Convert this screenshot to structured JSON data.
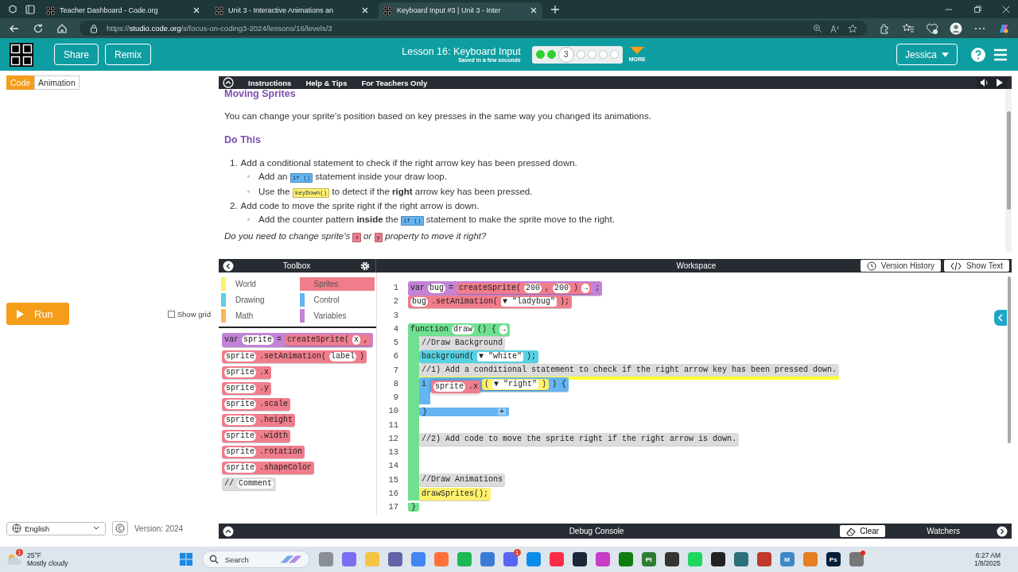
{
  "browser": {
    "tabs": [
      {
        "title": "Teacher Dashboard - Code.org",
        "selected": false
      },
      {
        "title": "Unit 3 - Interactive Animations an",
        "selected": false
      },
      {
        "title": "Keyboard Input #3 | Unit 3 - Inter",
        "selected": true
      }
    ],
    "url": "https://**studio.code.org**/s/focus-on-coding3-2024/lessons/16/levels/3"
  },
  "header": {
    "buttons": [
      "Share",
      "Remix"
    ],
    "lesson_title": "Lesson 16: Keyboard Input",
    "save_status": "Saved in a few seconds",
    "progress": [
      {
        "kind": "done"
      },
      {
        "kind": "done"
      },
      {
        "kind": "current",
        "label": "3"
      },
      {
        "kind": "empty"
      },
      {
        "kind": "empty"
      },
      {
        "kind": "empty"
      },
      {
        "kind": "empty"
      }
    ],
    "more_label": "MORE",
    "user": "Jessica"
  },
  "left_pane": {
    "tabs": [
      {
        "label": "Code",
        "selected": true
      },
      {
        "label": "Animation",
        "selected": false
      }
    ],
    "run_label": "Run",
    "show_grid": {
      "label": "Show grid",
      "checked": false
    },
    "language": "English",
    "version": "Version: 2024"
  },
  "instructions": {
    "tabs": [
      "Instructions",
      "Help & Tips",
      "For Teachers Only"
    ],
    "heading": "Moving Sprites",
    "intro": "You can change your sprite's position based on key presses in the same way you changed its animations.",
    "subheading": "Do This",
    "steps": [
      {
        "marker": "1.",
        "segments": [
          {
            "text": "Add a conditional statement to check if the right arrow key has been pressed down."
          }
        ],
        "children": [
          {
            "marker": "◦",
            "segments": [
              {
                "text": "Add an "
              },
              {
                "code": "if ()",
                "kind": "control"
              },
              {
                "text": " statement inside your draw loop."
              }
            ]
          },
          {
            "marker": "◦",
            "segments": [
              {
                "text": "Use the "
              },
              {
                "code": "keyDown()",
                "kind": "world"
              },
              {
                "text": " to detect if the **right** arrow key has been pressed."
              }
            ]
          }
        ]
      },
      {
        "marker": "2.",
        "segments": [
          {
            "text": "Add code to move the sprite right if the right arrow is down."
          }
        ],
        "children": [
          {
            "marker": "◦",
            "segments": [
              {
                "text": "Add the counter pattern **inside** the "
              },
              {
                "code": "if ()",
                "kind": "control"
              },
              {
                "text": " statement to make the sprite move to the right."
              }
            ]
          }
        ]
      }
    ],
    "question": [
      {
        "text": "Do you need to change sprite's "
      },
      {
        "code": "x",
        "kind": "sprites"
      },
      {
        "text": " or "
      },
      {
        "code": "y",
        "kind": "sprites"
      },
      {
        "text": " property to move it right?"
      }
    ]
  },
  "toolbox": {
    "title": "Toolbox",
    "categories": [
      {
        "label": "World",
        "color": "#fff06e",
        "selected": false
      },
      {
        "label": "Sprites",
        "color": "#f07d8b",
        "selected": true
      },
      {
        "label": "Drawing",
        "color": "#56d2e3",
        "selected": false
      },
      {
        "label": "Control",
        "color": "#64b5f2",
        "selected": false
      },
      {
        "label": "Math",
        "color": "#f7b955",
        "selected": false
      },
      {
        "label": "Variables",
        "color": "#c283d6",
        "selected": false
      }
    ],
    "blocks": [
      {
        "kind": "variables",
        "tokens": [
          {
            "kind": "text",
            "text": "var"
          },
          {
            "kind": "field",
            "text": "sprite"
          },
          {
            "kind": "text",
            "text": "="
          },
          {
            "kind": "sprites",
            "tokens": [
              {
                "kind": "text",
                "text": "createSprite("
              },
              {
                "kind": "field",
                "text": "x"
              },
              {
                "kind": "text",
                "text": ","
              }
            ]
          }
        ]
      },
      {
        "kind": "sprites",
        "tokens": [
          {
            "kind": "field",
            "text": "sprite"
          },
          {
            "kind": "text",
            "text": ".setAnimation("
          },
          {
            "kind": "field",
            "text": "label"
          },
          {
            "kind": "text",
            "text": ")"
          }
        ]
      },
      {
        "kind": "sprites",
        "tokens": [
          {
            "kind": "field",
            "text": "sprite"
          },
          {
            "kind": "text",
            "text": ".x"
          }
        ]
      },
      {
        "kind": "sprites",
        "tokens": [
          {
            "kind": "field",
            "text": "sprite"
          },
          {
            "kind": "text",
            "text": ".y"
          }
        ]
      },
      {
        "kind": "sprites",
        "tokens": [
          {
            "kind": "field",
            "text": "sprite"
          },
          {
            "kind": "text",
            "text": ".scale"
          }
        ]
      },
      {
        "kind": "sprites",
        "tokens": [
          {
            "kind": "field",
            "text": "sprite"
          },
          {
            "kind": "text",
            "text": ".height"
          }
        ]
      },
      {
        "kind": "sprites",
        "tokens": [
          {
            "kind": "field",
            "text": "sprite"
          },
          {
            "kind": "text",
            "text": ".width"
          }
        ]
      },
      {
        "kind": "sprites",
        "tokens": [
          {
            "kind": "field",
            "text": "sprite"
          },
          {
            "kind": "text",
            "text": ".rotation"
          }
        ]
      },
      {
        "kind": "sprites",
        "tokens": [
          {
            "kind": "field",
            "text": "sprite"
          },
          {
            "kind": "text",
            "text": ".shapeColor"
          }
        ]
      },
      {
        "kind": "comment",
        "tokens": [
          {
            "kind": "text",
            "text": "//"
          },
          {
            "kind": "field",
            "text": "Comment"
          }
        ]
      }
    ]
  },
  "workspace": {
    "title": "Workspace",
    "buttons": [
      "Version History",
      "Show Text"
    ],
    "lines": [
      {
        "number": "1",
        "block": {
          "kind": "variables",
          "tokens": [
            {
              "kind": "text",
              "text": "var"
            },
            {
              "kind": "field",
              "text": "bug"
            },
            {
              "kind": "text",
              "text": "="
            },
            {
              "kind": "sprites",
              "tokens": [
                {
                  "kind": "text",
                  "text": "createSprite("
                },
                {
                  "kind": "field",
                  "text": "200"
                },
                {
                  "kind": "text",
                  "text": ","
                },
                {
                  "kind": "field",
                  "text": "200"
                },
                {
                  "kind": "text",
                  "text": ")"
                },
                {
                  "kind": "field",
                  "text": "→"
                }
              ]
            },
            {
              "kind": "text",
              "text": ";"
            }
          ]
        }
      },
      {
        "number": "2",
        "block": {
          "kind": "sprites",
          "tokens": [
            {
              "kind": "field",
              "text": "bug"
            },
            {
              "kind": "text",
              "text": ".setAnimation("
            },
            {
              "kind": "dropdown",
              "text": "▼ \"ladybug\""
            },
            {
              "kind": "text",
              "text": ");"
            }
          ]
        }
      },
      {
        "number": "3"
      },
      {
        "number": "4",
        "block": {
          "kind": "function",
          "tokens": [
            {
              "kind": "text",
              "text": "function"
            },
            {
              "kind": "field",
              "text": "draw"
            },
            {
              "kind": "text",
              "text": "() {"
            },
            {
              "kind": "field",
              "text": "→"
            }
          ]
        },
        "children": [
          {
            "number": "5",
            "block": {
              "kind": "comment",
              "tokens": [
                {
                  "kind": "text",
                  "text": "//Draw Background"
                }
              ]
            }
          },
          {
            "number": "6",
            "block": {
              "kind": "drawing",
              "tokens": [
                {
                  "kind": "text",
                  "text": "background("
                },
                {
                  "kind": "dropdown",
                  "text": "▼ \"white\""
                },
                {
                  "kind": "text",
                  "text": ");"
                }
              ]
            }
          },
          {
            "number": "7",
            "block": {
              "kind": "comment",
              "highlighted": true,
              "tokens": [
                {
                  "kind": "text",
                  "text": "//1) Add a conditional statement to check if the right arrow key has been pressed down."
                }
              ]
            }
          },
          {
            "number": "8",
            "block": {
              "kind": "control",
              "tokens": [
                {
                  "kind": "text",
                  "text": "i"
                },
                {
                  "kind": "gap"
                },
                {
                  "kind": "keyboard",
                  "tokens": [
                    {
                      "kind": "text",
                      "text": "("
                    },
                    {
                      "kind": "dropdown",
                      "text": "▼ \"right\""
                    },
                    {
                      "kind": "text",
                      "text": ")"
                    }
                  ]
                },
                {
                  "kind": "text",
                  "text": ") {"
                }
              ]
            },
            "children": [
              {
                "number": "9"
              }
            ],
            "end": {
              "number": "10",
              "text": "}",
              "plus": "+"
            }
          },
          {
            "number": "11"
          },
          {
            "number": "12",
            "block": {
              "kind": "comment",
              "tokens": [
                {
                  "kind": "text",
                  "text": "//2) Add code to move the sprite right if the right arrow is down."
                }
              ]
            }
          },
          {
            "number": "13"
          },
          {
            "number": "14"
          },
          {
            "number": "15",
            "block": {
              "kind": "comment",
              "tokens": [
                {
                  "kind": "text",
                  "text": "//Draw Animations"
                }
              ]
            }
          },
          {
            "number": "16",
            "block": {
              "kind": "world",
              "tokens": [
                {
                  "kind": "text",
                  "text": "drawSprites();"
                }
              ]
            }
          }
        ],
        "end": {
          "number": "17",
          "text": "}"
        }
      }
    ],
    "dragged_block": {
      "kind": "sprites",
      "tokens": [
        {
          "kind": "field",
          "text": "sprite"
        },
        {
          "kind": "text",
          "text": ".x"
        }
      ]
    }
  },
  "debug": {
    "title": "Debug Console",
    "clear_label": "Clear",
    "watchers_label": "Watchers"
  },
  "taskbar": {
    "weather": {
      "temperature": "25°F",
      "condition": "Mostly cloudy",
      "badge": "1"
    },
    "search_placeholder": "Search",
    "apps": [
      {
        "color": "#8a8f96"
      },
      {
        "color": "#7b6cf0"
      },
      {
        "color": "#f4c542"
      },
      {
        "color": "#6264a7"
      },
      {
        "color": "#4285f4"
      },
      {
        "color": "#ff7139"
      },
      {
        "color": "#1db954"
      },
      {
        "color": "#3a7bd5"
      },
      {
        "color": "#5865f2",
        "badge": "1"
      },
      {
        "color": "#0c8ce9"
      },
      {
        "color": "#fa2d48"
      },
      {
        "color": "#1b2838"
      },
      {
        "color": "#c83cc8"
      },
      {
        "color": "#107c10"
      },
      {
        "color": "#2e7d32",
        "label": "Pt"
      },
      {
        "color": "#333333"
      },
      {
        "color": "#1ed760"
      },
      {
        "color": "#222222"
      },
      {
        "color": "#2a6f7a"
      },
      {
        "color": "#c0392b"
      },
      {
        "color": "#3f88c5",
        "label": "M"
      },
      {
        "color": "#e67e22"
      },
      {
        "color": "#001e36",
        "label": "Ps"
      },
      {
        "color": "#777777",
        "dot": true
      }
    ],
    "time": "6:27 AM",
    "date": "1/8/2025"
  }
}
